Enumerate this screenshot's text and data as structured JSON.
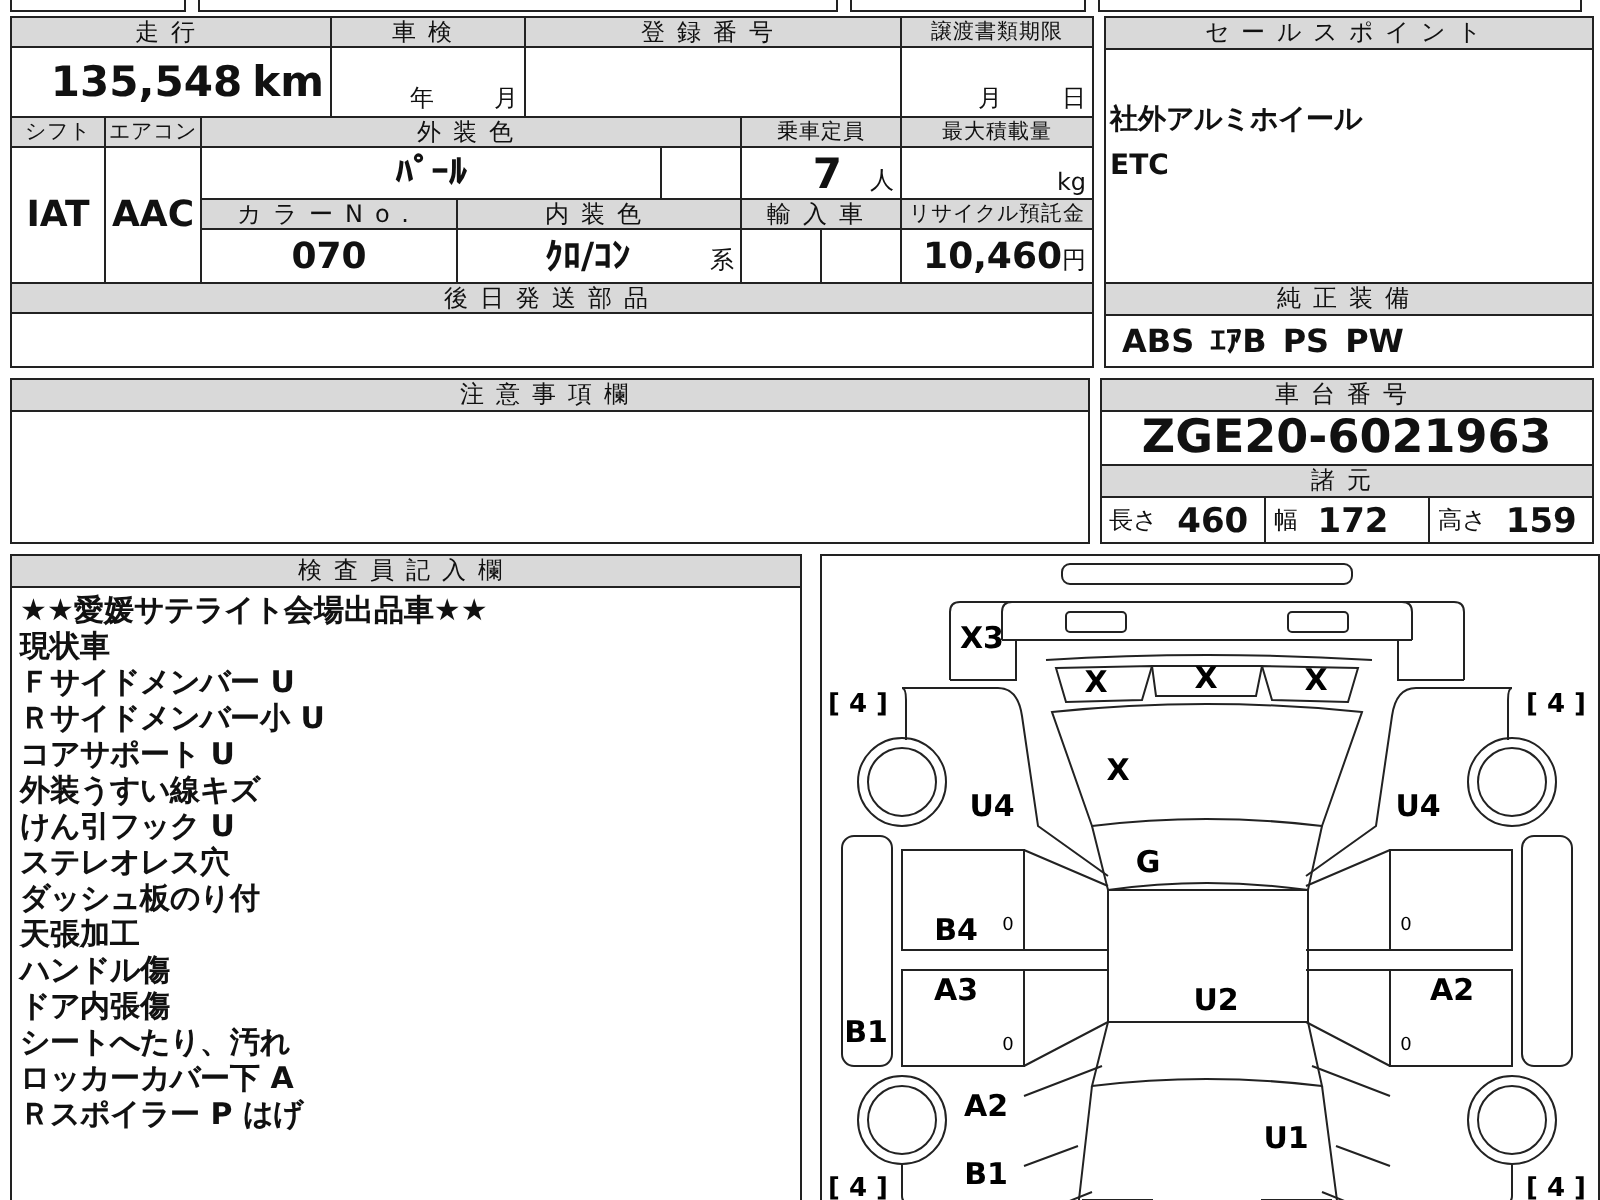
{
  "mileage": {
    "label": "走行",
    "value": "135,548",
    "unit": "km"
  },
  "inspection": {
    "label": "車検",
    "year_unit": "年",
    "month_unit": "月"
  },
  "registration_number": {
    "label": "登録番号"
  },
  "transfer_deadline": {
    "label": "譲渡書類期限",
    "month_unit": "月",
    "day_unit": "日"
  },
  "shift": {
    "label": "シフト",
    "value": "IAT"
  },
  "aircon": {
    "label": "エアコン",
    "value": "AAC"
  },
  "exterior_color": {
    "label": "外装色",
    "value": "ﾊﾟｰﾙ"
  },
  "capacity": {
    "label": "乗車定員",
    "value": "7",
    "unit": "人"
  },
  "max_load": {
    "label": "最大積載量",
    "unit": "kg"
  },
  "color_no": {
    "label": "カラーNo.",
    "value": "070"
  },
  "interior_color": {
    "label": "内装色",
    "value": "ｸﾛ/ｺﾝ",
    "suffix": "系"
  },
  "imported": {
    "label": "輸入車"
  },
  "recycle_deposit": {
    "label": "リサイクル預託金",
    "value": "10,460",
    "unit": "円"
  },
  "later_parts": {
    "label": "後日発送部品"
  },
  "sales_points": {
    "label": "セールスポイント",
    "items": [
      "社外アルミホイール",
      "ETC"
    ]
  },
  "standard_equipment": {
    "label": "純正装備",
    "items": [
      "ABS",
      "ｴｱB",
      "PS",
      "PW"
    ]
  },
  "notes": {
    "label": "注意事項欄"
  },
  "chassis_number": {
    "label": "車台番号",
    "value": "ZGE20-6021963"
  },
  "specs": {
    "label": "諸元",
    "items": [
      {
        "label": "長さ",
        "value": "460"
      },
      {
        "label": "幅",
        "value": "172"
      },
      {
        "label": "高さ",
        "value": "159"
      }
    ]
  },
  "inspector_notes": {
    "label": "検査員記入欄",
    "lines": [
      "★★愛媛サテライト会場出品車★★",
      "現状車",
      "Ｆサイドメンバー U",
      "Ｒサイドメンバー小 U",
      "コアサポート U",
      "外装うすい線キズ",
      "けん引フック U",
      "ステレオレス穴",
      "ダッシュ板のり付",
      "天張加工",
      "ハンドル傷",
      "ドア内張傷",
      "シートへたり、汚れ",
      "ロッカーカバー下 A",
      "Ｒスポイラー P はげ"
    ]
  },
  "damage_diagram": {
    "marks": [
      "X3",
      "X",
      "X",
      "X",
      "X",
      "U4",
      "U4",
      "G",
      "B4",
      "A3",
      "U2",
      "A2",
      "B1",
      "A2",
      "U1",
      "B1"
    ],
    "tire_treads": [
      "[ 4 ]",
      "[ 4 ]",
      "[ 4 ]",
      "[ 4 ]"
    ],
    "door_marks": [
      "0",
      "0",
      "0",
      "0"
    ]
  }
}
